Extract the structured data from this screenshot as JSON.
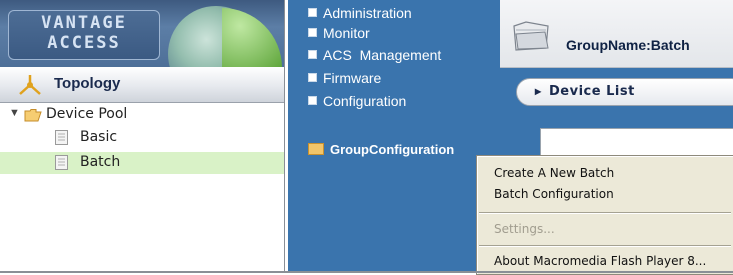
{
  "logo": {
    "line1": "VANTAGE",
    "line2": "ACCESS"
  },
  "topology": {
    "title": "Topology"
  },
  "tree": {
    "root": {
      "label": "Device Pool"
    },
    "children": [
      {
        "label": "Basic",
        "selected": false
      },
      {
        "label": "Batch",
        "selected": true
      }
    ]
  },
  "nav": {
    "items": [
      {
        "label": "Administration"
      },
      {
        "label": "Monitor"
      },
      {
        "label": "ACS  Management"
      },
      {
        "label": "Firmware"
      },
      {
        "label": "Configuration"
      }
    ],
    "folder": {
      "label": "GroupConfiguration"
    }
  },
  "group": {
    "name": "GroupName:Batch"
  },
  "device_list": {
    "label": "Device List",
    "arrow": "▸"
  },
  "context_menu": {
    "items": [
      {
        "label": "Create A New Batch",
        "enabled": true
      },
      {
        "label": "Batch Configuration",
        "enabled": true
      },
      {
        "label": "Settings...",
        "enabled": false
      },
      {
        "label": "About Macromedia Flash Player 8...",
        "enabled": true
      }
    ]
  },
  "colors": {
    "nav_blue": "#3a74ad",
    "selected_row": "#d9f2c7",
    "menu_bg": "#ece9d8"
  }
}
